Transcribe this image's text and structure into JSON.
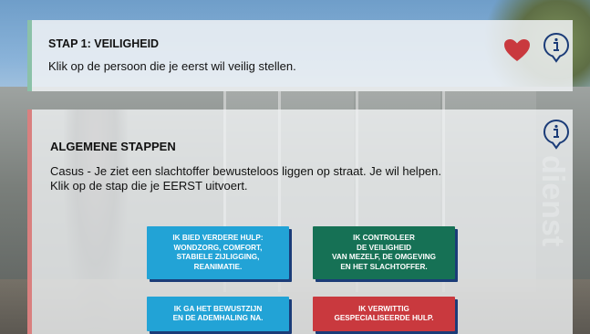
{
  "step_panel": {
    "title": "STAP 1: VEILIGHEID",
    "instruction": "Klik op de persoon die je eerst wil veilig stellen."
  },
  "main_panel": {
    "title": "ALGEMENE STAPPEN",
    "case_text": "Casus - Je ziet een slachtoffer bewusteloos liggen op straat. Je wil helpen.",
    "instruction": "Klik op de stap die je EERST uitvoert."
  },
  "background_text": "dienst",
  "options": {
    "further_help": "IK BIED VERDERE HULP:\nWONDZORG, COMFORT,\nSTABIELE ZIJLIGGING,\nREANIMATIE.",
    "check_safety": "IK CONTROLEER\nDE VEILIGHEID\nVAN MEZELF, DE OMGEVING\nEN HET SLACHTOFFER.",
    "check_consciousness": "IK GA HET BEWUSTZIJN\nEN DE ADEMHALING NA.",
    "call_help": "IK VERWITTIG\nGESPECIALISEERDE HULP."
  },
  "colors": {
    "blue_button": "#22a3d6",
    "green_button": "#167155",
    "red_button": "#c9393e",
    "heart": "#c9393e",
    "info_icon": "#1b3c78"
  },
  "icons": {
    "heart": "heart-icon",
    "info": "info-icon"
  }
}
